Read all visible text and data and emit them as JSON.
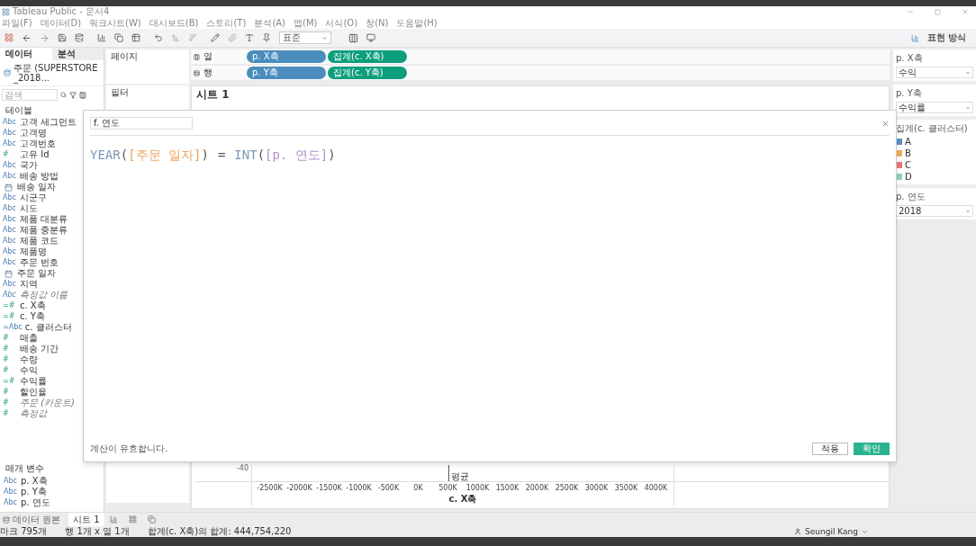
{
  "window": {
    "title": "Tableau Public - 문서4"
  },
  "menu": [
    "파일(F)",
    "데이터(D)",
    "워크시트(W)",
    "대시보드(B)",
    "스토리(T)",
    "분석(A)",
    "맵(M)",
    "서식(O)",
    "창(N)",
    "도움말(H)"
  ],
  "toolbar": {
    "mark_type": "표준",
    "show_me": "표현 방식"
  },
  "data_pane": {
    "tabs": [
      {
        "label": "데이터",
        "selected": true
      },
      {
        "label": "분석",
        "selected": false
      }
    ],
    "source": "주문 (SUPERSTORE_2018...",
    "search": {
      "placeholder": "검색"
    },
    "tables_heading": "테이블",
    "fields": [
      {
        "kind": "text",
        "icon_text": "Abc",
        "name": "고객 세그먼트",
        "italic": false
      },
      {
        "kind": "text",
        "icon_text": "Abc",
        "name": "고객명",
        "italic": false
      },
      {
        "kind": "text",
        "icon_text": "Abc",
        "name": "고객번호",
        "italic": false
      },
      {
        "kind": "number",
        "icon_text": "#",
        "name": "고유 Id",
        "italic": false
      },
      {
        "kind": "text",
        "icon_text": "Abc",
        "name": "국가",
        "italic": false
      },
      {
        "kind": "text",
        "icon_text": "Abc",
        "name": "배송 방법",
        "italic": false
      },
      {
        "kind": "date",
        "name": "배송 일자",
        "italic": false
      },
      {
        "kind": "text",
        "icon_text": "Abc",
        "name": "시군구",
        "italic": false
      },
      {
        "kind": "text",
        "icon_text": "Abc",
        "name": "시도",
        "italic": false
      },
      {
        "kind": "text",
        "icon_text": "Abc",
        "name": "제품 대분류",
        "italic": false
      },
      {
        "kind": "text",
        "icon_text": "Abc",
        "name": "제품 중분류",
        "italic": false
      },
      {
        "kind": "text",
        "icon_text": "Abc",
        "name": "제품 코드",
        "italic": false
      },
      {
        "kind": "text",
        "icon_text": "Abc",
        "name": "제품명",
        "italic": false
      },
      {
        "kind": "text",
        "icon_text": "Abc",
        "name": "주문 번호",
        "italic": false
      },
      {
        "kind": "date",
        "name": "주문 일자",
        "italic": false
      },
      {
        "kind": "text",
        "icon_text": "Abc",
        "name": "지역",
        "italic": false
      },
      {
        "kind": "text",
        "icon_text": "Abc",
        "name": "측정값 이름",
        "italic": true
      },
      {
        "kind": "number",
        "icon_text": "=#",
        "name": "c. X축",
        "italic": false
      },
      {
        "kind": "number",
        "icon_text": "=#",
        "name": "c. Y축",
        "italic": false
      },
      {
        "kind": "text",
        "icon_text": "=Abc",
        "name": "c. 클러스터",
        "italic": false
      },
      {
        "kind": "number",
        "icon_text": "#",
        "name": "매출",
        "italic": false
      },
      {
        "kind": "number",
        "icon_text": "#",
        "name": "배송 기간",
        "italic": false
      },
      {
        "kind": "number",
        "icon_text": "#",
        "name": "수량",
        "italic": false
      },
      {
        "kind": "number",
        "icon_text": "#",
        "name": "수익",
        "italic": false
      },
      {
        "kind": "number",
        "icon_text": "=#",
        "name": "수익률",
        "italic": false
      },
      {
        "kind": "number",
        "icon_text": "#",
        "name": "할인율",
        "italic": false
      },
      {
        "kind": "number",
        "icon_text": "#",
        "name": "주문 (카운트)",
        "italic": true
      },
      {
        "kind": "number",
        "icon_text": "#",
        "name": "측정값",
        "italic": true
      }
    ],
    "parameters_heading": "매개 변수",
    "parameters": [
      {
        "icon_text": "Abc",
        "name": "p. X축"
      },
      {
        "icon_text": "Abc",
        "name": "p. Y축"
      },
      {
        "icon_text": "Abc",
        "name": "p. 연도"
      }
    ]
  },
  "shelves": {
    "pages": "페이지",
    "filters": "필터",
    "columns": {
      "label": "열",
      "pills": [
        {
          "kind": "parameter",
          "label": "p. X축"
        },
        {
          "kind": "measure",
          "label": "집계(c. X축)"
        }
      ]
    },
    "rows": {
      "label": "행",
      "pills": [
        {
          "kind": "parameter",
          "label": "p. Y축"
        },
        {
          "kind": "measure",
          "label": "집계(c. Y축)"
        }
      ]
    }
  },
  "sheet": {
    "title": "시트 1",
    "y_tick": "-40",
    "reference_label": "평균",
    "x_title": "c. X축",
    "x_ticks": [
      "-2500K",
      "-2000K",
      "-1500K",
      "-1000K",
      "-500K",
      "0K",
      "500K",
      "1000K",
      "1500K",
      "2000K",
      "2500K",
      "3000K",
      "3500K",
      "4000K"
    ]
  },
  "calc_dialog": {
    "name": "f. 연도",
    "formula": [
      {
        "kind": "function",
        "text": "YEAR"
      },
      {
        "kind": "paren",
        "text": "("
      },
      {
        "kind": "field",
        "text": "[주문 일자]"
      },
      {
        "kind": "paren",
        "text": ")"
      },
      {
        "kind": "operator",
        "text": "="
      },
      {
        "kind": "function",
        "text": "INT"
      },
      {
        "kind": "paren",
        "text": "("
      },
      {
        "kind": "param",
        "text": "[p. 연도]"
      },
      {
        "kind": "paren",
        "text": ")"
      }
    ],
    "status": "계산이 유효합니다.",
    "buttons": [
      {
        "kind": "secondary",
        "label": "적용"
      },
      {
        "kind": "primary",
        "label": "확인"
      }
    ]
  },
  "right_panel": [
    {
      "kind": "dropdown",
      "title": "p. X축",
      "value": "수익"
    },
    {
      "kind": "dropdown",
      "title": "p. Y축",
      "value": "수익률"
    },
    {
      "kind": "legend",
      "title": "집계(c. 클러스터)",
      "items": [
        {
          "label": "A",
          "color": "#5b8fc6"
        },
        {
          "label": "B",
          "color": "#f4a85e"
        },
        {
          "label": "C",
          "color": "#e8777a"
        },
        {
          "label": "D",
          "color": "#8fcfc8"
        }
      ]
    },
    {
      "kind": "dropdown",
      "title": "p. 연도",
      "value": "2018"
    }
  ],
  "sheet_tabs": {
    "data_source": "데이터 원본",
    "tabs": [
      {
        "label": "시트 1",
        "selected": true
      }
    ]
  },
  "status_bar": {
    "marks": "마크 795개",
    "dims": "행 1개 x 열 1개",
    "sum": "합계(c. X축)의 합계: 444,754,220",
    "user": "Seungil Kang"
  }
}
